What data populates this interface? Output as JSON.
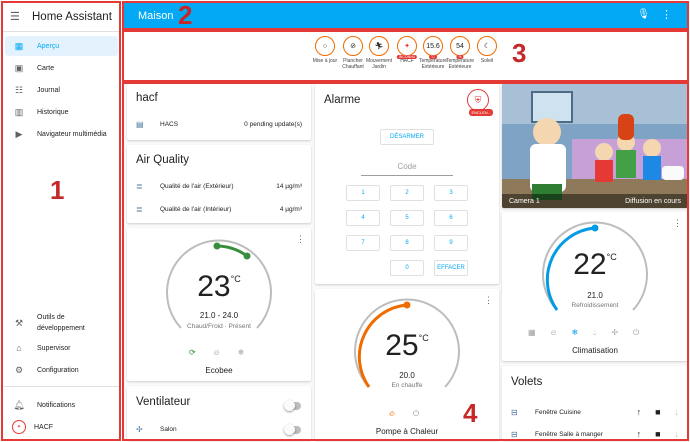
{
  "sidebar": {
    "title": "Home Assistant",
    "items": [
      {
        "label": "Aperçu",
        "icon": "dashboard-icon"
      },
      {
        "label": "Carte",
        "icon": "map-icon"
      },
      {
        "label": "Journal",
        "icon": "list-icon"
      },
      {
        "label": "Historique",
        "icon": "chart-icon"
      },
      {
        "label": "Navigateur multimédia",
        "icon": "media-icon"
      }
    ],
    "bottom_items": [
      {
        "label": "Outils de développement",
        "icon": "hammer-icon"
      },
      {
        "label": "Supervisor",
        "icon": "home-assistant-icon"
      },
      {
        "label": "Configuration",
        "icon": "gear-icon"
      },
      {
        "label": "Notifications",
        "icon": "bell-icon"
      },
      {
        "label": "HACF",
        "icon": "avatar"
      }
    ]
  },
  "topbar": {
    "title": "Maison"
  },
  "annotations": [
    "1",
    "2",
    "3",
    "4"
  ],
  "badges": [
    {
      "value": "",
      "label": "Mise à jour"
    },
    {
      "value": "",
      "label": "Plancher Chauffant"
    },
    {
      "value": "",
      "label": "Mouvement Jardin"
    },
    {
      "value": "",
      "label": "HACF",
      "tag": "INCONNU"
    },
    {
      "value": "15.6",
      "label": "Température Extérieure",
      "tag": "°C"
    },
    {
      "value": "54",
      "label": "Température Extérieure",
      "tag": "%"
    },
    {
      "value": "",
      "label": "Soleil"
    }
  ],
  "hacf_card": {
    "title": "hacf",
    "row_label": "HACS",
    "row_value": "0 pending update(s)"
  },
  "air_card": {
    "title": "Air Quality",
    "rows": [
      {
        "label": "Qualité de l'air (Extérieur)",
        "value": "14 µg/m³"
      },
      {
        "label": "Qualité de l'air (Intérieur)",
        "value": "4 µg/m³"
      }
    ]
  },
  "ecobee": {
    "temp": "23",
    "unit": "°C",
    "range": "21.0 - 24.0",
    "mode": "Chaud/Froid · Présent",
    "name": "Ecobee"
  },
  "ventilateur": {
    "title": "Ventilateur",
    "row_label": "Salon"
  },
  "alarme": {
    "title": "Alarme",
    "state_tag": "ENCLEN...",
    "disarm_label": "DÉSARMER",
    "code_placeholder": "Code",
    "keys": [
      "1",
      "2",
      "3",
      "4",
      "5",
      "6",
      "7",
      "8",
      "9",
      "0",
      "EFFACER"
    ]
  },
  "pac": {
    "temp": "25",
    "unit": "°C",
    "setpoint": "20.0",
    "status": "En chauffe",
    "name": "Pompe à Chaleur"
  },
  "camera": {
    "name": "Camera 1",
    "status": "Diffusion en cours"
  },
  "clim": {
    "temp": "22",
    "unit": "°C",
    "setpoint": "21.0",
    "status": "Refroidissement",
    "name": "Climatisation"
  },
  "volets": {
    "title": "Volets",
    "rows": [
      {
        "label": "Fenêtre Cuisine"
      },
      {
        "label": "Fenêtre Salle à manger"
      }
    ]
  },
  "colors": {
    "accent": "#03a9f4",
    "heat": "#ef6c00",
    "cool": "#039be5",
    "eco": "#388e3c",
    "annotation": "#e53935"
  }
}
